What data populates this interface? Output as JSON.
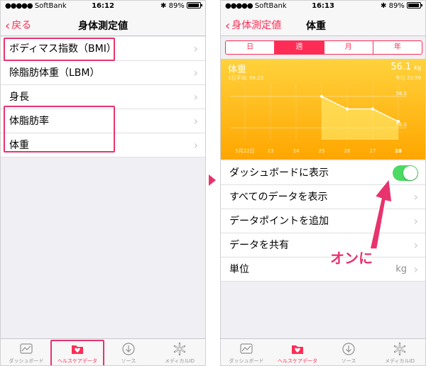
{
  "left": {
    "status": {
      "carrier": "SoftBank",
      "time": "16:12",
      "battery": "89%"
    },
    "nav": {
      "back": "戻る",
      "title": "身体測定値"
    },
    "rows": [
      {
        "label": "ボディマス指数（BMI）"
      },
      {
        "label": "除脂肪体重（LBM）"
      },
      {
        "label": "身長"
      },
      {
        "label": "体脂肪率"
      },
      {
        "label": "体重"
      }
    ],
    "tabs": [
      {
        "label": "ダッシュボード",
        "icon": "dashboard-icon"
      },
      {
        "label": "ヘルスケアデータ",
        "icon": "healthcare-data-icon"
      },
      {
        "label": "ソース",
        "icon": "sources-download-icon"
      },
      {
        "label": "メディカルID",
        "icon": "medical-id-icon"
      }
    ]
  },
  "right": {
    "status": {
      "carrier": "SoftBank",
      "time": "16:13",
      "battery": "89%"
    },
    "nav": {
      "back": "身体測定値",
      "title": "体重"
    },
    "segments": [
      "日",
      "週",
      "月",
      "年"
    ],
    "card": {
      "title": "体重",
      "subtitle": "1日平均: 56.23",
      "value": "56.1",
      "unit": "kg",
      "right_sub": "今日 23:59"
    },
    "rows": [
      {
        "label": "ダッシュボードに表示"
      },
      {
        "label": "すべてのデータを表示"
      },
      {
        "label": "データポイントを追加"
      },
      {
        "label": "データを共有"
      },
      {
        "label": "単位",
        "value": "kg"
      }
    ],
    "toggle_on": true,
    "tabs": [
      {
        "label": "ダッシュボード"
      },
      {
        "label": "ヘルスケアデータ"
      },
      {
        "label": "ソース"
      },
      {
        "label": "メディカルID"
      }
    ]
  },
  "chart_data": {
    "type": "line",
    "title": "",
    "categories": [
      "5月22日",
      "23",
      "24",
      "25",
      "26",
      "27",
      "28"
    ],
    "series": [
      {
        "values": [
          null,
          null,
          null,
          56.5,
          56.3,
          56.3,
          56.1
        ]
      }
    ],
    "y_ticks": [
      "56.5",
      "56.0"
    ],
    "ylim": [
      55.9,
      56.6
    ],
    "grid": true
  },
  "annotation": {
    "callout": "オンに"
  },
  "colors": {
    "accent": "#ff2d55",
    "highlight": "#e8336e",
    "toggle": "#4cd964",
    "chart_top": "#ffd23c",
    "chart_bottom": "#ffa600"
  }
}
